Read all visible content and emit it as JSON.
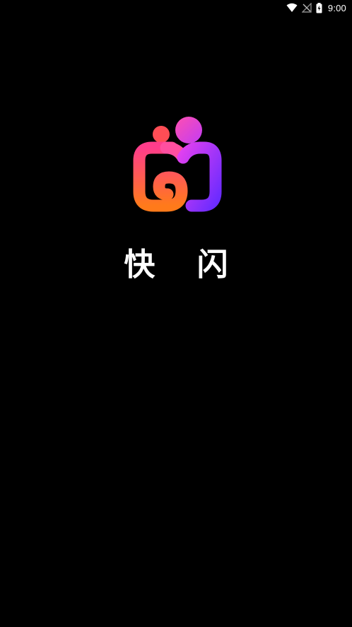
{
  "status_bar": {
    "time": "9:00",
    "icons": [
      "wifi-icon",
      "no-signal-icon",
      "battery-charging-icon"
    ]
  },
  "splash": {
    "app_name": "快 闪",
    "logo_icon": "app-logo-icon"
  },
  "colors": {
    "background": "#000000",
    "logo_pink": "#ff3d8b",
    "logo_orange": "#ff7a1a",
    "logo_purple": "#c33cff",
    "logo_violet": "#6a2bff",
    "small_dot": "#ff4d55",
    "big_dot": "#e63cf0"
  }
}
